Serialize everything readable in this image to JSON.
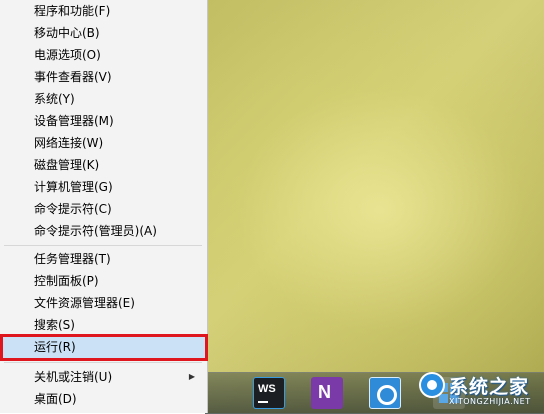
{
  "context_menu": {
    "groups": [
      [
        {
          "label": "程序和功能(F)"
        },
        {
          "label": "移动中心(B)"
        },
        {
          "label": "电源选项(O)"
        },
        {
          "label": "事件查看器(V)"
        },
        {
          "label": "系统(Y)"
        },
        {
          "label": "设备管理器(M)"
        },
        {
          "label": "网络连接(W)"
        },
        {
          "label": "磁盘管理(K)"
        },
        {
          "label": "计算机管理(G)"
        },
        {
          "label": "命令提示符(C)"
        },
        {
          "label": "命令提示符(管理员)(A)"
        }
      ],
      [
        {
          "label": "任务管理器(T)"
        },
        {
          "label": "控制面板(P)"
        },
        {
          "label": "文件资源管理器(E)"
        },
        {
          "label": "搜索(S)"
        },
        {
          "label": "运行(R)",
          "highlighted": true
        }
      ],
      [
        {
          "label": "关机或注销(U)",
          "has_submenu": true
        },
        {
          "label": "桌面(D)"
        }
      ]
    ],
    "highlight_color": "#e0161f"
  },
  "taskbar": {
    "icons": [
      {
        "name": "webstorm-icon",
        "text": "WS"
      },
      {
        "name": "onenote-icon",
        "text": "N"
      },
      {
        "name": "app-blue-icon"
      },
      {
        "name": "windows-flag-icon"
      }
    ]
  },
  "watermark": {
    "title": "系统之家",
    "url": "XITONGZHIJIA.NET"
  }
}
